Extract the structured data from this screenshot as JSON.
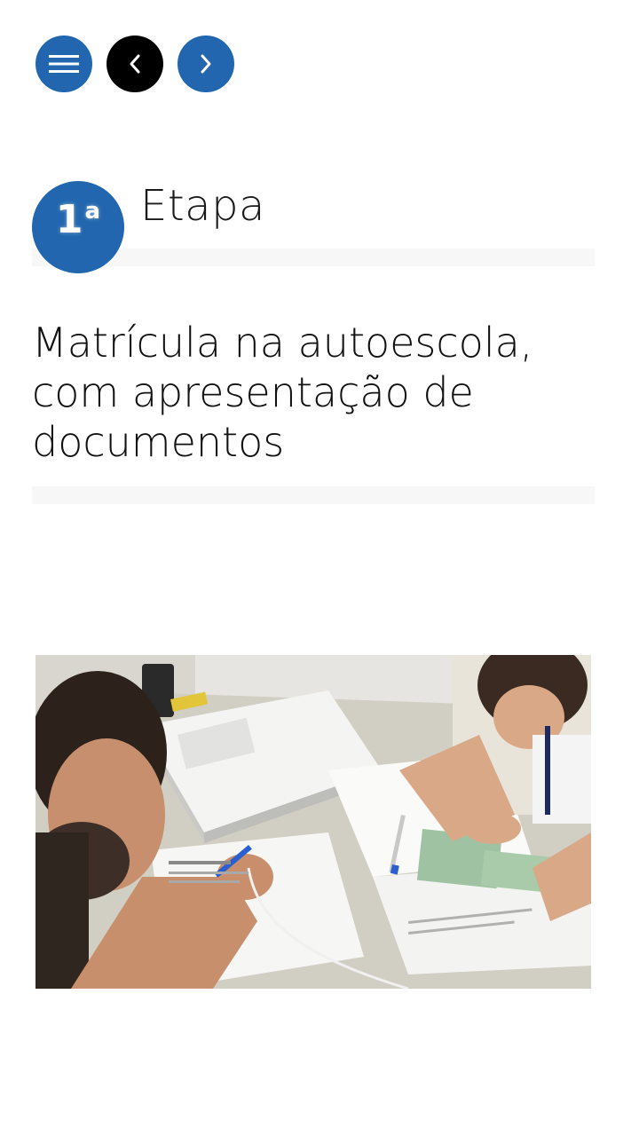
{
  "nav": {
    "menu_icon": "hamburger-menu-icon",
    "prev_icon": "chevron-left-icon",
    "next_icon": "chevron-right-icon",
    "menu_color": "#2166ae",
    "prev_color": "#000000",
    "next_color": "#2166ae"
  },
  "step": {
    "number": "1",
    "ordinal": "a",
    "label": "Etapa",
    "title": "Matrícula na autoescola, com apresentação de documentos"
  },
  "colors": {
    "accent": "#2166ae",
    "divider": "#f7f7f7",
    "text": "#111111"
  }
}
